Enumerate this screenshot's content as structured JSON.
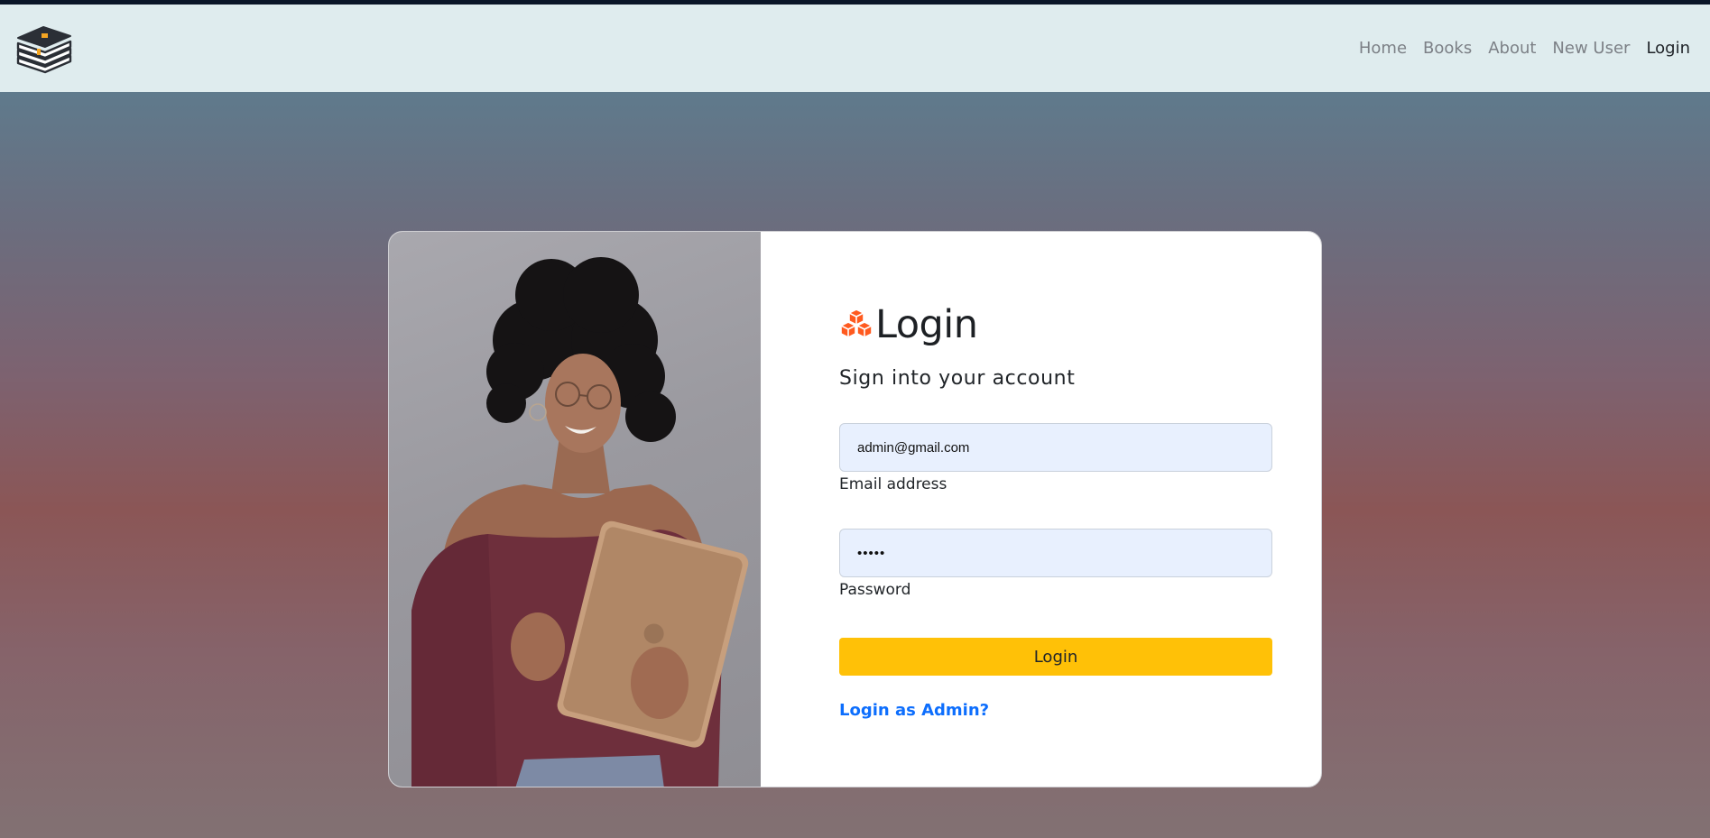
{
  "nav": {
    "logo_icon": "books-stack-icon",
    "links": [
      {
        "label": "Home",
        "active": false
      },
      {
        "label": "Books",
        "active": false
      },
      {
        "label": "About",
        "active": false
      },
      {
        "label": "New User",
        "active": false
      },
      {
        "label": "Login",
        "active": true
      }
    ]
  },
  "card": {
    "photo_icon": "woman-with-tablet-photo",
    "title_icon": "cubes-icon",
    "title": "Login",
    "subtitle": "Sign into your account",
    "email": {
      "value": "admin@gmail.com",
      "label": "Email address"
    },
    "password": {
      "value": "•••••",
      "label": "Password"
    },
    "login_button": "Login",
    "admin_link": "Login as Admin?"
  },
  "colors": {
    "navbar_bg": "#dfecee",
    "accent_button": "#ffc107",
    "link": "#0d6efd",
    "input_bg": "#e8f0fe",
    "cubes": "#ff5a1f"
  }
}
